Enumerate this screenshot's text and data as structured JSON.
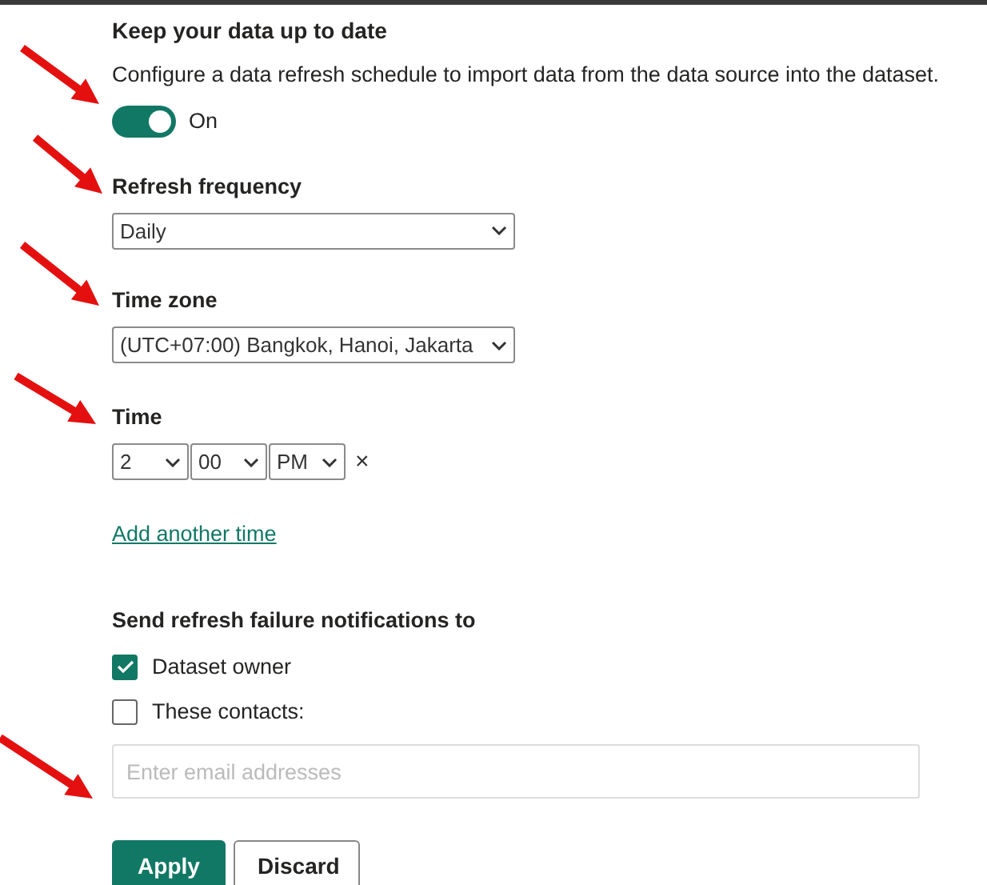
{
  "section": {
    "title": "Keep your data up to date",
    "description": "Configure a data refresh schedule to import data from the data source into the dataset."
  },
  "toggle": {
    "on": true,
    "label": "On"
  },
  "refresh_frequency": {
    "label": "Refresh frequency",
    "value": "Daily"
  },
  "time_zone": {
    "label": "Time zone",
    "value": "(UTC+07:00) Bangkok, Hanoi, Jakarta"
  },
  "time": {
    "label": "Time",
    "hour": "2",
    "minute": "00",
    "period": "PM",
    "remove": "×"
  },
  "add_time_link": "Add another time",
  "notifications": {
    "label": "Send refresh failure notifications to",
    "options": [
      {
        "label": "Dataset owner",
        "checked": true
      },
      {
        "label": "These contacts:",
        "checked": false
      }
    ],
    "email_placeholder": "Enter email addresses"
  },
  "buttons": [
    {
      "label": "Apply",
      "kind": "primary"
    },
    {
      "label": "Discard",
      "kind": "secondary"
    }
  ]
}
